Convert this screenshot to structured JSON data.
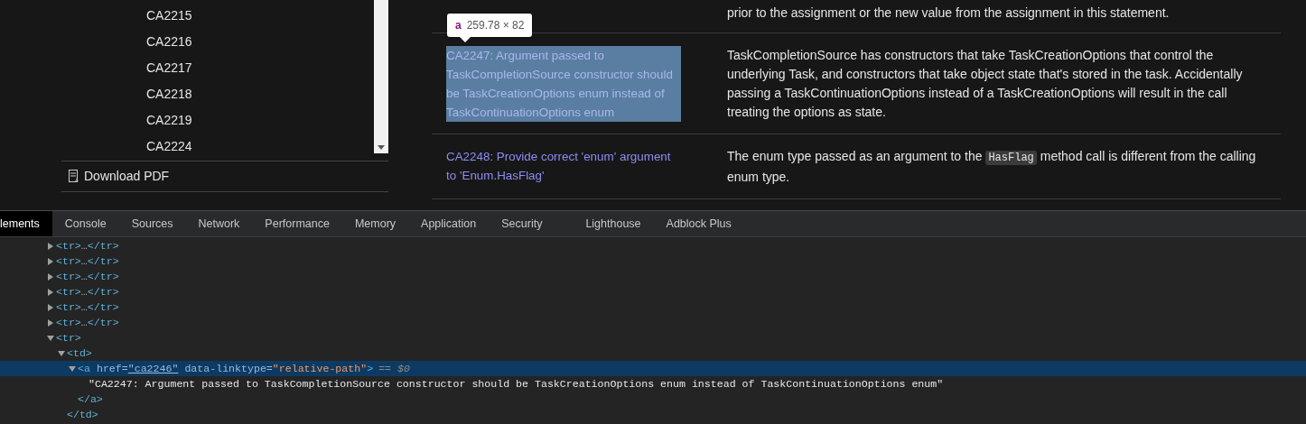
{
  "sidebar": {
    "items": [
      {
        "label": "CA2215",
        "selected": false
      },
      {
        "label": "CA2216",
        "selected": false
      },
      {
        "label": "CA2217",
        "selected": false
      },
      {
        "label": "CA2218",
        "selected": false
      },
      {
        "label": "CA2219",
        "selected": false
      },
      {
        "label": "CA2224",
        "selected": false
      }
    ],
    "download": "Download PDF"
  },
  "table": {
    "rows": [
      {
        "rule": null,
        "description": [
          {
            "kind": "text",
            "text": "prior to the assignment or the new value from the assignment in this statement."
          }
        ]
      },
      {
        "rule": "CA2247: Argument passed to TaskCompletionSource constructor should be TaskCreationOptions enum instead of TaskContinuationOptions enum",
        "highlighted": true,
        "description": [
          {
            "kind": "text",
            "text": "TaskCompletionSource has constructors that take TaskCreationOptions that control the underlying Task, and constructors that take object state that's stored in the task. Accidentally passing a TaskContinuationOptions instead of a TaskCreationOptions will result in the call treating the options as state."
          }
        ]
      },
      {
        "rule": "CA2248: Provide correct 'enum' argument to 'Enum.HasFlag'",
        "highlighted": false,
        "description": [
          {
            "kind": "text",
            "text": "The enum type passed as an argument to the "
          },
          {
            "kind": "code",
            "text": "HasFlag"
          },
          {
            "kind": "text",
            "text": " method call is different from the calling enum type."
          }
        ]
      }
    ]
  },
  "inspect_tooltip": {
    "tag": "a",
    "size": "259.78 × 82"
  },
  "devtools": {
    "tabs": [
      {
        "label": "lements",
        "selected": true
      },
      {
        "label": "Console",
        "selected": false
      },
      {
        "label": "Sources",
        "selected": false
      },
      {
        "label": "Network",
        "selected": false
      },
      {
        "label": "Performance",
        "selected": false
      },
      {
        "label": "Memory",
        "selected": false
      },
      {
        "label": "Application",
        "selected": false
      },
      {
        "label": "Security",
        "selected": false
      },
      {
        "label": "Lighthouse",
        "selected": false
      },
      {
        "label": "Adblock Plus",
        "selected": false
      }
    ],
    "dom_tree": [
      {
        "open": "<tr>",
        "ellipsis": "…",
        "close": "</tr>",
        "expanded": false,
        "selected": false
      },
      {
        "open": "<tr>",
        "ellipsis": "…",
        "close": "</tr>",
        "expanded": false,
        "selected": false
      },
      {
        "open": "<tr>",
        "ellipsis": "…",
        "close": "</tr>",
        "expanded": false,
        "selected": false
      },
      {
        "open": "<tr>",
        "ellipsis": "…",
        "close": "</tr>",
        "expanded": false,
        "selected": false
      },
      {
        "open": "<tr>",
        "ellipsis": "…",
        "close": "</tr>",
        "expanded": false,
        "selected": false
      },
      {
        "open": "<tr>",
        "ellipsis": "…",
        "close": "</tr>",
        "expanded": false,
        "selected": false
      },
      {
        "open": "<tr>",
        "expanded": true,
        "selected": false,
        "children": [
          {
            "open": "<td>",
            "close": "</td>",
            "expanded": true,
            "selected": false,
            "children": [
              {
                "open": "<a",
                "attributes": [
                  {
                    "name": "href=",
                    "value": "\"ca2246\"",
                    "link": true
                  },
                  {
                    "name": "data-linktype=",
                    "value": "\"relative-path\"",
                    "link": false
                  }
                ],
                "open_end": ">",
                "marker": "== $0",
                "close": "</a>",
                "expanded": true,
                "selected": true,
                "children": [
                  {
                    "text": "\"CA2247: Argument passed to TaskCompletionSource constructor should be TaskCreationOptions enum instead of TaskContinuationOptions enum\""
                  }
                ]
              }
            ]
          }
        ]
      }
    ]
  }
}
